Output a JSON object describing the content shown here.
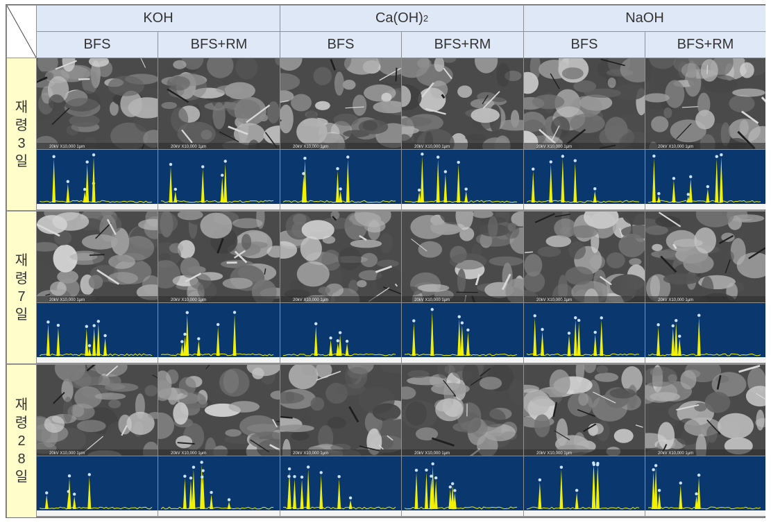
{
  "header": {
    "groups": [
      "KOH",
      "Ca(OH)",
      "NaOH"
    ],
    "group_subscript": "2",
    "columns": [
      "BFS",
      "BFS+RM",
      "BFS",
      "BFS+RM",
      "BFS",
      "BFS+RM"
    ]
  },
  "rows": [
    {
      "label": "재\n령\n3\n일"
    },
    {
      "label": "재\n령\n7\n일"
    },
    {
      "label": "재\n령\n2\n8\n일"
    }
  ],
  "sem_caption": "20kV   X10,000   1μm",
  "colors": {
    "header_bg": "#dfe8f6",
    "age_bg": "#fffdc9",
    "eds_bg": "#0b376f",
    "peak": "#f2f200"
  }
}
